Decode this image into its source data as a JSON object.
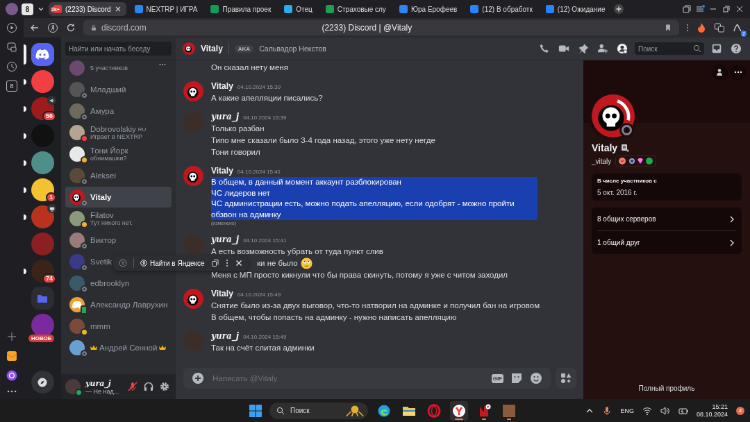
{
  "browser": {
    "tab_count": "8",
    "tabs": [
      {
        "title": "(2233) Discord",
        "selected": true,
        "color": "#e53935",
        "favicon_badge": "2k+"
      },
      {
        "title": "NEXTRP | ИГРА",
        "selected": false,
        "color": "#2787f5"
      },
      {
        "title": "Правила проек",
        "selected": false,
        "color": "#0f9d58"
      },
      {
        "title": "Отец",
        "selected": false,
        "color": "#2aabee"
      },
      {
        "title": "Страховые слу",
        "selected": false,
        "color": "#1e9e50"
      },
      {
        "title": "Юра Ерофеев",
        "selected": false,
        "color": "#2787f5"
      },
      {
        "title": "(12) В обработк",
        "selected": false,
        "color": "#2684ff"
      },
      {
        "title": "(12) Ожидание",
        "selected": false,
        "color": "#2684ff"
      }
    ],
    "url": "discord.com",
    "page_title": "(2233) Discord | @Vitaly",
    "extension_badge": "2",
    "rail_counter": "8"
  },
  "servers": [
    {
      "kind": "home",
      "selected": true,
      "unread": false,
      "color": "#5865f2"
    },
    {
      "kind": "server",
      "selected": false,
      "unread": true,
      "color": "#f23f42"
    },
    {
      "kind": "server",
      "selected": false,
      "unread": true,
      "color": "#9e1b1b",
      "badge": "56",
      "activity": {
        "kind": "voice"
      }
    },
    {
      "kind": "server",
      "selected": false,
      "unread": true,
      "color": "#111111"
    },
    {
      "kind": "server",
      "selected": false,
      "unread": true,
      "color": "#4f8f8a"
    },
    {
      "kind": "server",
      "selected": false,
      "unread": true,
      "color": "#f2c230",
      "badge": "1"
    },
    {
      "kind": "server",
      "selected": false,
      "unread": true,
      "color": "#b8321f",
      "activity": {
        "kind": "screen"
      }
    },
    {
      "kind": "server",
      "selected": false,
      "unread": false,
      "color": "#8c1f22"
    },
    {
      "kind": "server",
      "selected": false,
      "unread": true,
      "color": "#3a2418",
      "badge": "74"
    },
    {
      "kind": "folder",
      "selected": false,
      "unread": false,
      "color": "#5865f2"
    },
    {
      "kind": "server",
      "selected": false,
      "unread": false,
      "color": "#7a2a9e",
      "label": "НОВОЕ"
    }
  ],
  "dm": {
    "search_placeholder": "Найти или начать беседу",
    "items": [
      {
        "kind": "group",
        "subtitle": "5 участников",
        "selected": false,
        "color": "#6b4a6e"
      },
      {
        "kind": "offline",
        "name": "Младший",
        "selected": false,
        "color": "#555555"
      },
      {
        "kind": "offline",
        "name": "Амура",
        "selected": false,
        "color": "#6d6a5c"
      },
      {
        "kind": "dnd",
        "name": "Dobrovolskiy",
        "tag": "RU",
        "subtitle": "Играет в NEXTRP",
        "selected": false,
        "color": "#b3a58f"
      },
      {
        "kind": "idle",
        "name": "Тони Йорк",
        "subtitle": "обнимашки?",
        "selected": false,
        "color": "#e8e8e8"
      },
      {
        "kind": "offline",
        "name": "Aleksei",
        "selected": false,
        "color": "#5a4a3a"
      },
      {
        "kind": "offline",
        "name": "Vitaly",
        "selected": true,
        "color": "#c0181e",
        "avatar": {
          "kind": "skull"
        }
      },
      {
        "kind": "idle",
        "name": "Filatov",
        "subtitle": "Тут никого нет.",
        "selected": false,
        "color": "#8a9a7a"
      },
      {
        "kind": "offline",
        "name": "Виктор",
        "selected": false,
        "color": "#9a7a7a"
      },
      {
        "kind": "offline",
        "name": "Svetik",
        "selected": false,
        "color": "#3a3a8a"
      },
      {
        "kind": "offline",
        "name": "edbrooklyn",
        "selected": false,
        "color": "#3a5a6a"
      },
      {
        "kind": "mobile",
        "name": "Александр Лаврухин",
        "selected": false,
        "color": "#f0a030",
        "avatar": {
          "kind": "discord"
        }
      },
      {
        "kind": "idle",
        "name": "mmm",
        "selected": false,
        "color": "#7a4a3a"
      },
      {
        "kind": "offline",
        "name": "Андрей Сенной",
        "crowns": true,
        "selected": false,
        "color": "#6aa0d0"
      }
    ],
    "user": {
      "name": "yura_j",
      "status_text": "— Не над...",
      "mic_muted": true
    }
  },
  "chat": {
    "recipient": "Vitaly",
    "aka": "AKA",
    "alias": "Сальвадор Некстов",
    "search_placeholder": "Поиск",
    "input_placeholder": "Написать @Vitaly",
    "gif": "GIF",
    "groups": [
      {
        "kind": "continuation",
        "messages": [
          {
            "text": "Он сказал нету меня",
            "selected": false
          }
        ]
      },
      {
        "kind": "group",
        "author": "Vitaly",
        "avatar": {
          "kind": "skull"
        },
        "time": "04.10.2024 15:39",
        "messages": [
          {
            "text": "А какие апелляции писались?",
            "selected": false
          }
        ]
      },
      {
        "kind": "group",
        "author": "yura_j",
        "avatar": {
          "kind": "photo"
        },
        "time": "04.10.2024 15:39",
        "messages": [
          {
            "text": "Только разбан",
            "selected": false
          },
          {
            "text": "Типо мне сказали было 3-4 года назад, этого уже нету негде",
            "selected": false
          },
          {
            "text": "Тони говорил",
            "selected": false
          }
        ]
      },
      {
        "kind": "group",
        "author": "Vitaly",
        "avatar": {
          "kind": "skull"
        },
        "time": "04.10.2024 15:41",
        "messages": [
          {
            "text": "В общем, в данный момент аккаунт разблокирован\nЧС лидеров нет\nЧС администрации есть, можно подать апелляцию, если одобрят - можно пройти обзвон на админку",
            "selected": true,
            "edited": "(изменено)"
          }
        ]
      },
      {
        "kind": "group",
        "author": "yura_j",
        "avatar": {
          "kind": "photo"
        },
        "time": "04.10.2024 15:41",
        "messages": [
          {
            "text": "А есть возможность убрать от туда пункт слив",
            "selected": false
          },
          {
            "text": "ки не было",
            "selected": false,
            "partial": true,
            "emoji": true
          },
          {
            "text": "Меня с МП просто кикнули что бы права скинуть, потому я уже с читом заходил",
            "selected": false
          }
        ]
      },
      {
        "kind": "group",
        "author": "Vitaly",
        "avatar": {
          "kind": "skull"
        },
        "time": "04.10.2024 15:49",
        "messages": [
          {
            "text": "Снятие было из-за двух выговор, что-то натворил на админке и получил бан на игровом",
            "selected": false
          },
          {
            "text": "В общем, чтобы попасть на админку - нужно написать апелляцию",
            "selected": false
          }
        ]
      },
      {
        "kind": "group",
        "author": "yura_j",
        "avatar": {
          "kind": "photo"
        },
        "time": "04.10.2024 15:49",
        "messages": [
          {
            "text": "Так на счёт слитая админки",
            "selected": false
          }
        ]
      }
    ]
  },
  "popup": {
    "action": "Найти в Яндексе"
  },
  "profile": {
    "name": "Vitaly",
    "handle": "_vitaly",
    "member_since_label": "В числе участников с",
    "member_since": "5 окт. 2016 г.",
    "links": [
      "8 общих серверов",
      "1 общий друг"
    ],
    "full_profile": "Полный профиль"
  },
  "taskbar": {
    "search_placeholder": "Поиск",
    "apps": [
      {
        "kind": "edge",
        "running": false,
        "selected": false
      },
      {
        "kind": "explorer",
        "running": false,
        "selected": false
      },
      {
        "kind": "opera",
        "running": false,
        "selected": false
      },
      {
        "kind": "yandex",
        "running": true,
        "selected": true
      },
      {
        "kind": "app",
        "running": true,
        "selected": false
      },
      {
        "kind": "photo",
        "running": true,
        "selected": false
      }
    ],
    "language": "ENG",
    "time": "15:21",
    "date": "08.10.2024",
    "notifications": "4"
  }
}
